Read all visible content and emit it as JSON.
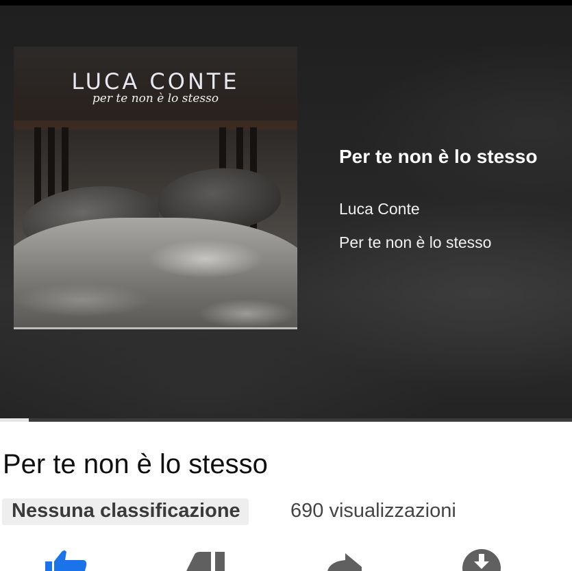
{
  "player": {
    "cover": {
      "artist_text": "LUCA CONTE",
      "album_text": "per te non è lo stesso"
    },
    "track_title": "Per te non è lo stesso",
    "artist": "Luca Conte",
    "album": "Per te non è lo stesso",
    "progress_fraction": 0.05
  },
  "video": {
    "title": "Per te non è lo stesso",
    "rating_badge": "Nessuna classificazione",
    "views": "690 visualizzazioni"
  },
  "actions": [
    {
      "name": "like",
      "icon": "thumbs-up-icon",
      "color": "#1a73e8"
    },
    {
      "name": "dislike",
      "icon": "thumbs-down-icon",
      "color": "#606060"
    },
    {
      "name": "share",
      "icon": "share-icon",
      "color": "#606060"
    },
    {
      "name": "download",
      "icon": "download-icon",
      "color": "#606060"
    }
  ]
}
